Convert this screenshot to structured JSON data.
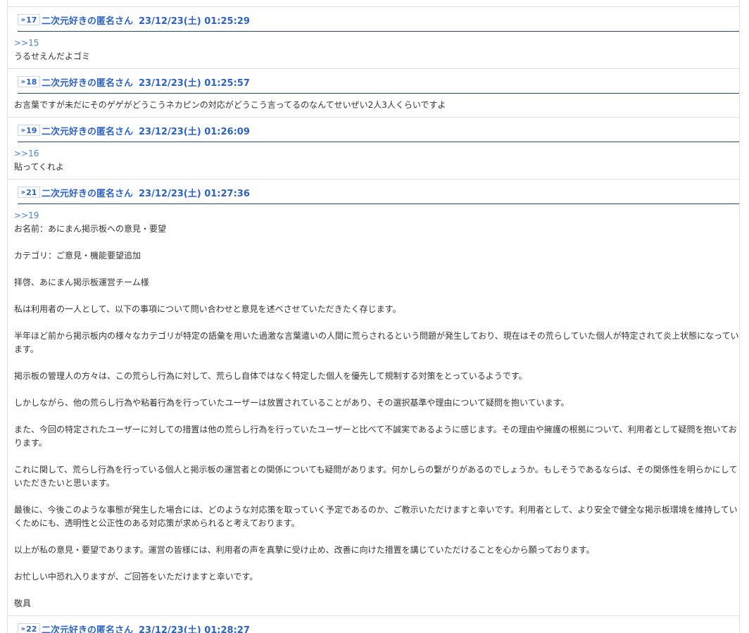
{
  "colors": {
    "link": "#2a62c9",
    "divider": "#1f4e79",
    "anchor": "#4a7fd6"
  },
  "posts": [
    {
      "num": "17",
      "name": "二次元好きの匿名さん",
      "date": "23/12/23(土) 01:25:29",
      "anchor": ">>15",
      "lines": [
        "うるせえんだよゴミ"
      ]
    },
    {
      "num": "18",
      "name": "二次元好きの匿名さん",
      "date": "23/12/23(土) 01:25:57",
      "anchor": "",
      "lines": [
        "お言葉ですが未だにそのゲゲがどうこうネカピンの対応がどうこう言ってるのなんてせいぜい2人3人くらいですよ"
      ]
    },
    {
      "num": "19",
      "name": "二次元好きの匿名さん",
      "date": "23/12/23(土) 01:26:09",
      "anchor": ">>16",
      "lines": [
        "貼ってくれよ"
      ]
    },
    {
      "num": "21",
      "name": "二次元好きの匿名さん",
      "date": "23/12/23(土) 01:27:36",
      "anchor": ">>19",
      "lines": [
        "お名前：あにまん掲示板への意見・要望",
        "",
        "カテゴリ：ご意見・機能要望追加",
        "",
        "拝啓、あにまん掲示板運営チーム様",
        "",
        "私は利用者の一人として、以下の事項について問い合わせと意見を述べさせていただきたく存じます。",
        "",
        "半年ほど前から掲示板内の様々なカテゴリが特定の語彙を用いた過激な言葉遣いの人間に荒らされるという問題が発生しており、現在はその荒らしていた個人が特定されて炎上状態になっています。",
        "",
        "掲示板の管理人の方々は、この荒らし行為に対して、荒らし自体ではなく特定した個人を優先して規制する対策をとっているようです。",
        "",
        "しかしながら、他の荒らし行為や粘着行為を行っていたユーザーは放置されていることがあり、その選択基準や理由について疑問を抱いています。",
        "",
        "また、今回の特定されたユーザーに対しての措置は他の荒らし行為を行っていたユーザーと比べて不誠実であるように感じます。その理由や擁護の根拠について、利用者として疑問を抱いております。",
        "",
        "これに関して、荒らし行為を行っている個人と掲示板の運営者との関係についても疑問があります。何かしらの繋がりがあるのでしょうか。もしそうであるならば、その関係性を明らかにしていただきたいと思います。",
        "",
        "最後に、今後このような事態が発生した場合には、どのような対応策を取っていく予定であるのか、ご教示いただけますと幸いです。利用者として、より安全で健全な掲示板環境を維持していくためにも、透明性と公正性のある対応策が求められると考えております。",
        "",
        "以上が私の意見・要望であります。運営の皆様には、利用者の声を真摯に受け止め、改善に向けた措置を講じていただけることを心から願っております。",
        "",
        "お忙しい中恐れ入りますが、ご回答をいただけますと幸いです。",
        "",
        "敬具"
      ]
    },
    {
      "num": "22",
      "name": "二次元好きの匿名さん",
      "date": "23/12/23(土) 01:28:27",
      "anchor": "",
      "lines": []
    }
  ]
}
